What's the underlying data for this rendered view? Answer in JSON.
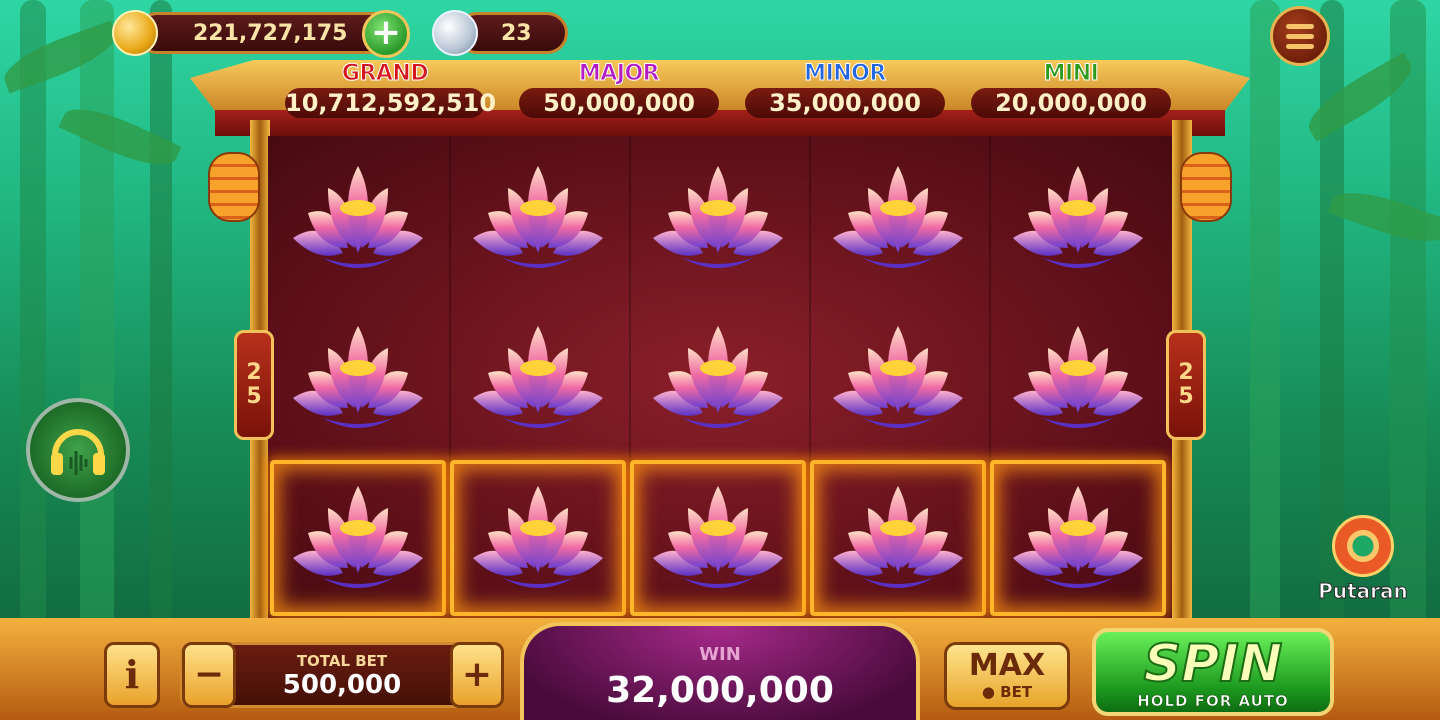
{
  "balance": {
    "coins": "221,727,175",
    "tokens": "23"
  },
  "jackpots": [
    {
      "label": "GRAND",
      "value": "10,712,592,510",
      "color": "#d4161e"
    },
    {
      "label": "MAJOR",
      "value": "50,000,000",
      "color": "#b31cc4"
    },
    {
      "label": "MINOR",
      "value": "35,000,000",
      "color": "#2266e0"
    },
    {
      "label": "MINI",
      "value": "20,000,000",
      "color": "#2c9a1c"
    }
  ],
  "paylines": {
    "left": [
      "2",
      "5"
    ],
    "right": [
      "2",
      "5"
    ]
  },
  "reels": {
    "symbol": "lotus-flower",
    "rows": [
      [
        "lotus",
        "lotus",
        "lotus",
        "lotus",
        "lotus"
      ],
      [
        "lotus",
        "lotus",
        "lotus",
        "lotus",
        "lotus"
      ],
      [
        "lotus",
        "lotus",
        "lotus",
        "lotus",
        "lotus"
      ]
    ],
    "winning_row": 3
  },
  "putaran": {
    "label": "Putaran"
  },
  "bottom_bar": {
    "info_label": "i",
    "minus_label": "−",
    "plus_label": "+",
    "total_bet_title": "TOTAL BET",
    "total_bet_value": "500,000",
    "win_title": "WIN",
    "win_value": "32,000,000",
    "max_label": "MAX",
    "max_sub": "● BET",
    "spin_label": "SPIN",
    "spin_sub": "HOLD FOR AUTO"
  },
  "icons": {
    "coin": "gold-coin-icon",
    "add": "plus-icon",
    "token": "silver-token-icon",
    "menu": "hamburger-menu-icon",
    "audio": "headphones-icon"
  },
  "colors": {
    "accent_gold": "#f2c45a",
    "spin_green": "#2fb52c",
    "reel_bg": "#6a1420"
  }
}
